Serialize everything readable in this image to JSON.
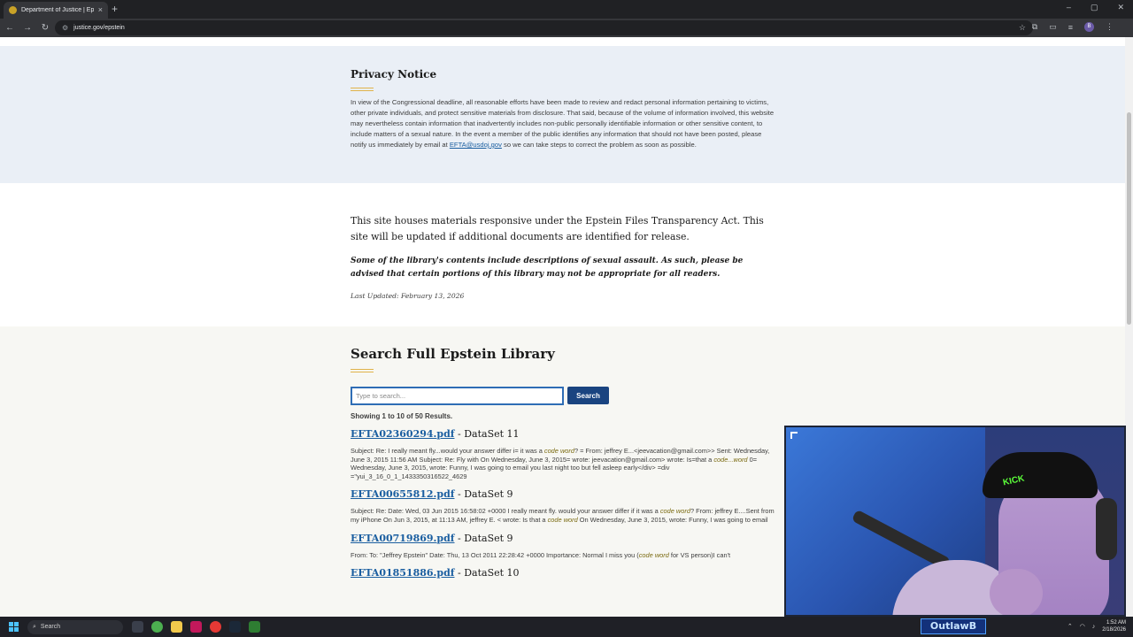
{
  "browser": {
    "tab_title": "Department of Justice | Epstein",
    "tab_close": "×",
    "new_tab": "+",
    "url": "justice.gov/epstein",
    "window_controls": [
      "–",
      "▢",
      "✕"
    ]
  },
  "privacy": {
    "title": "Privacy Notice",
    "text_before": "In view of the Congressional deadline, all reasonable efforts have been made to review and redact personal information pertaining to victims, other private individuals, and protect sensitive materials from disclosure. That said, because of the volume of information involved, this website may nevertheless contain information that inadvertently includes non-public personally identifiable information or other sensitive content, to include matters of a sexual nature. In the event a member of the public identifies any information that should not have been posted, please notify us immediately by email at",
    "email": "EFTA@usdoj.gov",
    "text_after": "so we can take steps to correct the problem as soon as possible."
  },
  "about": {
    "statement": "This site houses materials responsive under the Epstein Files Transparency Act. This site will be updated if additional documents are identified for release.",
    "warning": "Some of the library's contents include descriptions of sexual assault. As such, please be advised that certain portions of this library may not be appropriate for all readers.",
    "last_updated": "Last Updated: February 13, 2026"
  },
  "search": {
    "title": "Search Full Epstein Library",
    "placeholder": "Type to search...",
    "button_label": "Search",
    "results_summary": "Showing 1 to 10 of 50 Results."
  },
  "results": [
    {
      "file": "EFTA02360294.pdf",
      "dataset": " - DataSet 11",
      "snippet_parts": [
        "Subject: Re: I really meant fly...would your answer differ i= it was a ",
        "code word",
        "? = From: jeffrey E...<jeevacation@gmail.com>> Sent: Wednesday, June 3, 2015 11:56 AM Subject: Re: Fly with On Wednesday, June 3, 2015= wrote: jeevacation@gmail.com> wrote: Is=that a ",
        "code...word",
        " 0= Wednesday, June 3, 2015, wrote: Funny, I was going to email you last night too but fell asleep early</div> =div =\"yui_3_16_0_1_1433350316522_4629"
      ]
    },
    {
      "file": "EFTA00655812.pdf",
      "dataset": " - DataSet 9",
      "snippet_parts": [
        "Subject: Re: Date: Wed, 03 Jun 2015 16:58:02 +0000 I really meant fly. would your answer differ if it was a ",
        "code word",
        "? From: jeffrey E....Sent from my iPhone On Jun 3, 2015, at 11:13 AM, jeffrey E. < wrote: Is that a ",
        "code word",
        " On Wednesday, June 3, 2015, wrote: Funny, I was going to email"
      ]
    },
    {
      "file": "EFTA00719869.pdf",
      "dataset": " - DataSet 9",
      "snippet_parts": [
        "From: To: \"Jeffrey Epstein\" Date: Thu, 13 Oct 2011 22:28:42 +0000 Importance: Normal I miss you (",
        "code word",
        " for VS person)I can't"
      ]
    },
    {
      "file": "EFTA01851886.pdf",
      "dataset": " - DataSet 10",
      "snippet_parts": [
        "",
        "",
        ""
      ]
    }
  ],
  "webcam": {
    "hat_text": "KICK"
  },
  "taskbar": {
    "search_label": "Search",
    "overlay_name": "OutlawB",
    "time": "1:52 AM",
    "date": "2/18/2026"
  },
  "colors": {
    "link": "#1a5ea0",
    "button": "#1a4480",
    "accent_rule": "#e0b34a",
    "privacy_band": "#eaeff6"
  }
}
